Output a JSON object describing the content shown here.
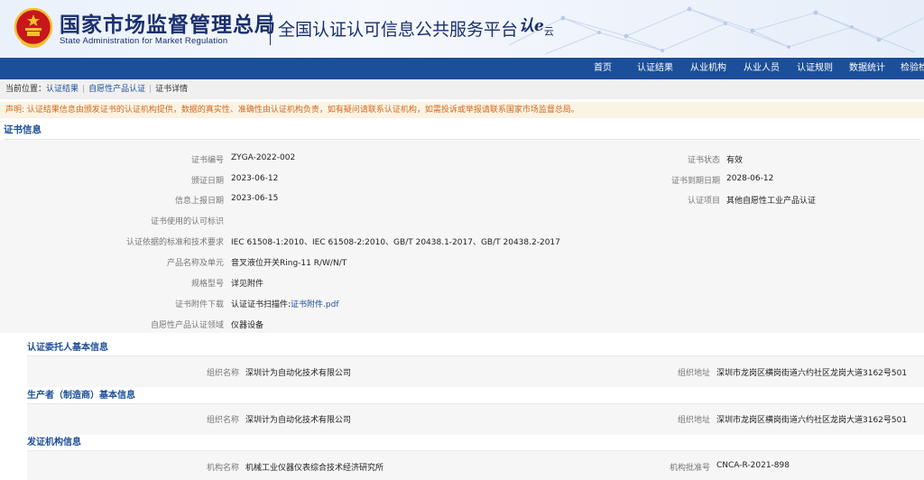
{
  "header": {
    "org_cn": "国家市场监督管理总局",
    "org_en": "State Administration  for  Market Regulation",
    "platform": "全国认证认可信息公共服务平台",
    "brand_main": "认e",
    "brand_sub": "云",
    "colors": {
      "header_text": "#1a2f6e",
      "nav_bg": "#1c4f99",
      "emblem_red": "#c8161d",
      "emblem_gold": "#f2c12e"
    }
  },
  "nav": {
    "items": [
      "首页",
      "认证结果",
      "从业机构",
      "从业人员",
      "认证规则",
      "数据统计",
      "检验检"
    ]
  },
  "breadcrumb": {
    "prefix": "当前位置：",
    "items": [
      "认证结果",
      "自愿性产品认证",
      "证书详情"
    ],
    "sep": "|"
  },
  "notice": "声明: 认证结果信息由颁发证书的认证机构提供，数据的真实性、准确性由认证机构负责，如有疑问请联系认证机构，如需投诉或举报请联系国家市场监督总局。",
  "certificate": {
    "section_title": "证书信息",
    "left": [
      {
        "label": "证书编号",
        "value": "ZYGA-2022-002"
      },
      {
        "label": "颁证日期",
        "value": "2023-06-12"
      },
      {
        "label": "信息上报日期",
        "value": "2023-06-15"
      },
      {
        "label": "证书使用的认可标识",
        "value": ""
      },
      {
        "label": "认证依据的标准和技术要求",
        "value": "IEC 61508-1:2010、IEC 61508-2:2010、GB/T 20438.1-2017、GB/T 20438.2-2017"
      },
      {
        "label": "产品名称及单元",
        "value": "音叉液位开关Ring-11 R/W/N/T"
      },
      {
        "label": "规格型号",
        "value": "详见附件"
      },
      {
        "label": "证书附件下载",
        "value": "认证证书扫描件:",
        "link": "证书附件.pdf"
      },
      {
        "label": "自愿性产品认证领域",
        "value": "仪器设备"
      }
    ],
    "right": [
      {
        "label": "证书状态",
        "value": "有效"
      },
      {
        "label": "证书到期日期",
        "value": "2028-06-12"
      },
      {
        "label": "认证项目",
        "value": "其他自愿性工业产品认证"
      }
    ]
  },
  "applicant": {
    "title": "认证委托人基本信息",
    "org_name_label": "组织名称",
    "org_name": "深圳计为自动化技术有限公司",
    "org_addr_label": "组织地址",
    "org_addr": "深圳市龙岗区横岗街道六约社区龙岗大道3162号501"
  },
  "manufacturer": {
    "title": "生产者（制造商）基本信息",
    "org_name_label": "组织名称",
    "org_name": "深圳计为自动化技术有限公司",
    "org_addr_label": "组织地址",
    "org_addr": "深圳市龙岗区横岗街道六约社区龙岗大道3162号501"
  },
  "issuer": {
    "title": "发证机构信息",
    "name_label": "机构名称",
    "name": "机械工业仪器仪表综合技术经济研究所",
    "approval_label": "机构批准号",
    "approval": "CNCA-R-2021-898"
  }
}
